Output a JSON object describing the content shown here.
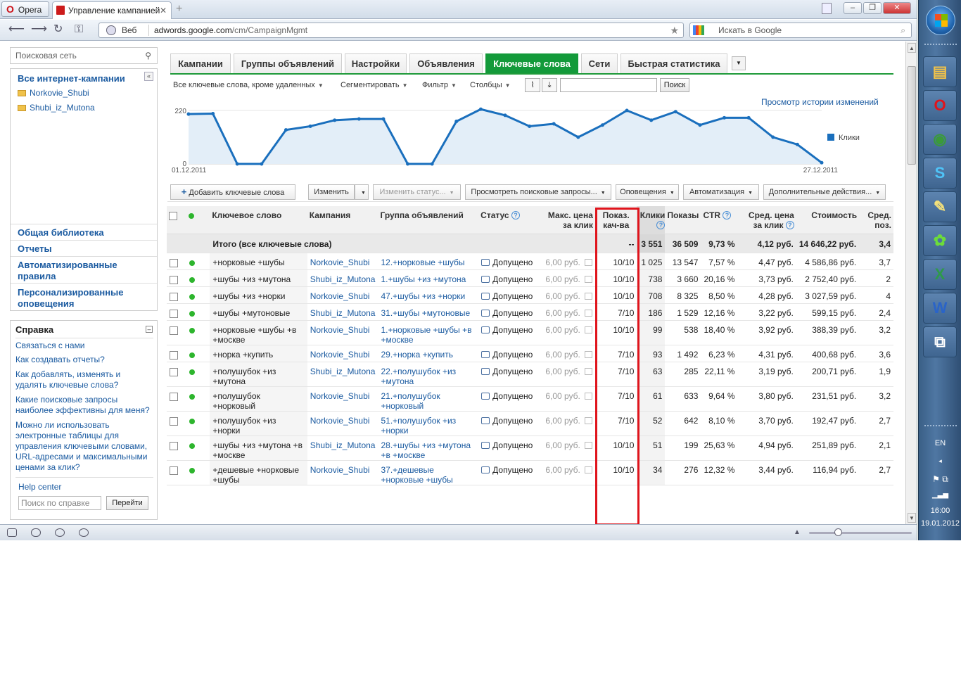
{
  "browser": {
    "menu_label": "Opera",
    "tab_title": "Управление кампанией",
    "address_prefix_label": "Веб",
    "url_domain": "adwords.google.com",
    "url_path": "/cm/CampaignMgmt",
    "search_placeholder": "Искать в Google"
  },
  "sidebar": {
    "search_placeholder": "Поисковая сеть",
    "all_campaigns": "Все интернет-кампании",
    "campaigns": [
      "Norkovie_Shubi",
      "Shubi_iz_Mutona"
    ],
    "links": [
      "Общая библиотека",
      "Отчеты",
      "Автоматизированные правила",
      "Персонализированные оповещения"
    ],
    "help": {
      "title": "Справка",
      "links": [
        "Связаться с нами",
        "Как создавать отчеты?",
        "Как добавлять, изменять и удалять ключевые слова?",
        "Какие поисковые запросы наиболее эффективны для меня?",
        "Можно ли использовать электронные таблицы для управления ключевыми словами, URL-адресами и максимальными ценами за клик?"
      ],
      "help_center": "Help center",
      "search_placeholder": "Поиск по справке",
      "go_button": "Перейти"
    }
  },
  "tabs": [
    "Кампании",
    "Группы объявлений",
    "Настройки",
    "Объявления",
    "Ключевые слова",
    "Сети",
    "Быстрая статистика"
  ],
  "active_tab": "Ключевые слова",
  "toolbar": {
    "filter_view": "Все ключевые слова, кроме удаленных",
    "segment": "Сегментировать",
    "filter": "Фильтр",
    "columns": "Столбцы",
    "search_button": "Поиск"
  },
  "history_link": "Просмотр истории изменений",
  "chart_data": {
    "type": "line",
    "x_start_label": "01.12.2011",
    "x_end_label": "27.12.2011",
    "y_ticks": [
      0,
      220
    ],
    "ylim": [
      0,
      220
    ],
    "series": [
      {
        "name": "Клики",
        "color": "#1a6fbd",
        "values": [
          205,
          207,
          0,
          0,
          140,
          155,
          180,
          185,
          185,
          0,
          0,
          175,
          225,
          200,
          155,
          165,
          110,
          160,
          220,
          180,
          215,
          160,
          190,
          190,
          110,
          80,
          5
        ]
      }
    ],
    "legend": "Клики",
    "legend_position": "right"
  },
  "actions": {
    "add_keywords": "Добавить ключевые слова",
    "edit": "Изменить",
    "change_status": "Изменить статус...",
    "view_queries": "Просмотреть поисковые запросы...",
    "alerts": "Оповещения",
    "automate": "Автоматизация",
    "more_actions": "Дополнительные действия..."
  },
  "table": {
    "headers": {
      "keyword": "Ключевое слово",
      "campaign": "Кампания",
      "ad_group": "Группа объявлений",
      "status": "Статус",
      "max_cpc": "Макс. цена за клик",
      "quality": "Показ. кач-ва",
      "clicks": "Клики",
      "impressions": "Показы",
      "ctr": "CTR",
      "avg_cpc": "Сред. цена за клик",
      "cost": "Стоимость",
      "avg_pos": "Сред. поз."
    },
    "total": {
      "label": "Итого (все ключевые слова)",
      "quality": "--",
      "clicks": "3 551",
      "impressions": "36 509",
      "ctr": "9,73 %",
      "avg_cpc": "4,12 руб.",
      "cost": "14 646,22 руб.",
      "avg_pos": "3,4"
    },
    "rows": [
      {
        "keyword": "+норковые +шубы",
        "campaign": "Norkovie_Shubi",
        "group": "12.+норковые +шубы",
        "status": "Допущено",
        "max_cpc": "6,00 руб.",
        "quality": "10/10",
        "clicks": "1 025",
        "impressions": "13 547",
        "ctr": "7,57 %",
        "avg_cpc": "4,47 руб.",
        "cost": "4 586,86 руб.",
        "pos": "3,7"
      },
      {
        "keyword": "+шубы +из +мутона",
        "campaign": "Shubi_iz_Mutona",
        "group": "1.+шубы +из +мутона",
        "status": "Допущено",
        "max_cpc": "6,00 руб.",
        "quality": "10/10",
        "clicks": "738",
        "impressions": "3 660",
        "ctr": "20,16 %",
        "avg_cpc": "3,73 руб.",
        "cost": "2 752,40 руб.",
        "pos": "2"
      },
      {
        "keyword": "+шубы +из +норки",
        "campaign": "Norkovie_Shubi",
        "group": "47.+шубы +из +норки",
        "status": "Допущено",
        "max_cpc": "6,00 руб.",
        "quality": "10/10",
        "clicks": "708",
        "impressions": "8 325",
        "ctr": "8,50 %",
        "avg_cpc": "4,28 руб.",
        "cost": "3 027,59 руб.",
        "pos": "4"
      },
      {
        "keyword": "+шубы +мутоновые",
        "campaign": "Shubi_iz_Mutona",
        "group": "31.+шубы +мутоновые",
        "status": "Допущено",
        "max_cpc": "6,00 руб.",
        "quality": "7/10",
        "clicks": "186",
        "impressions": "1 529",
        "ctr": "12,16 %",
        "avg_cpc": "3,22 руб.",
        "cost": "599,15 руб.",
        "pos": "2,4"
      },
      {
        "keyword": "+норковые +шубы +в +москве",
        "campaign": "Norkovie_Shubi",
        "group": "1.+норковые +шубы +в +москве",
        "status": "Допущено",
        "max_cpc": "6,00 руб.",
        "quality": "10/10",
        "clicks": "99",
        "impressions": "538",
        "ctr": "18,40 %",
        "avg_cpc": "3,92 руб.",
        "cost": "388,39 руб.",
        "pos": "3,2"
      },
      {
        "keyword": "+норка +купить",
        "campaign": "Norkovie_Shubi",
        "group": "29.+норка +купить",
        "status": "Допущено",
        "max_cpc": "6,00 руб.",
        "quality": "7/10",
        "clicks": "93",
        "impressions": "1 492",
        "ctr": "6,23 %",
        "avg_cpc": "4,31 руб.",
        "cost": "400,68 руб.",
        "pos": "3,6"
      },
      {
        "keyword": "+полушубок +из +мутона",
        "campaign": "Shubi_iz_Mutona",
        "group": "22.+полушубок +из +мутона",
        "status": "Допущено",
        "max_cpc": "6,00 руб.",
        "quality": "7/10",
        "clicks": "63",
        "impressions": "285",
        "ctr": "22,11 %",
        "avg_cpc": "3,19 руб.",
        "cost": "200,71 руб.",
        "pos": "1,9"
      },
      {
        "keyword": "+полушубок +норковый",
        "campaign": "Norkovie_Shubi",
        "group": "21.+полушубок +норковый",
        "status": "Допущено",
        "max_cpc": "6,00 руб.",
        "quality": "7/10",
        "clicks": "61",
        "impressions": "633",
        "ctr": "9,64 %",
        "avg_cpc": "3,80 руб.",
        "cost": "231,51 руб.",
        "pos": "3,2"
      },
      {
        "keyword": "+полушубок +из +норки",
        "campaign": "Norkovie_Shubi",
        "group": "51.+полушубок +из +норки",
        "status": "Допущено",
        "max_cpc": "6,00 руб.",
        "quality": "7/10",
        "clicks": "52",
        "impressions": "642",
        "ctr": "8,10 %",
        "avg_cpc": "3,70 руб.",
        "cost": "192,47 руб.",
        "pos": "2,7"
      },
      {
        "keyword": "+шубы +из +мутона +в +москве",
        "campaign": "Shubi_iz_Mutona",
        "group": "28.+шубы +из +мутона +в +москве",
        "status": "Допущено",
        "max_cpc": "6,00 руб.",
        "quality": "10/10",
        "clicks": "51",
        "impressions": "199",
        "ctr": "25,63 %",
        "avg_cpc": "4,94 руб.",
        "cost": "251,89 руб.",
        "pos": "2,1"
      },
      {
        "keyword": "+дешевые +норковые +шубы",
        "campaign": "Norkovie_Shubi",
        "group": "37.+дешевые +норковые +шубы",
        "status": "Допущено",
        "max_cpc": "6,00 руб.",
        "quality": "10/10",
        "clicks": "34",
        "impressions": "276",
        "ctr": "12,32 %",
        "avg_cpc": "3,44 руб.",
        "cost": "116,94 руб.",
        "pos": "2,7"
      }
    ]
  },
  "tray": {
    "language": "EN",
    "time": "16:00",
    "date": "19.01.2012"
  }
}
